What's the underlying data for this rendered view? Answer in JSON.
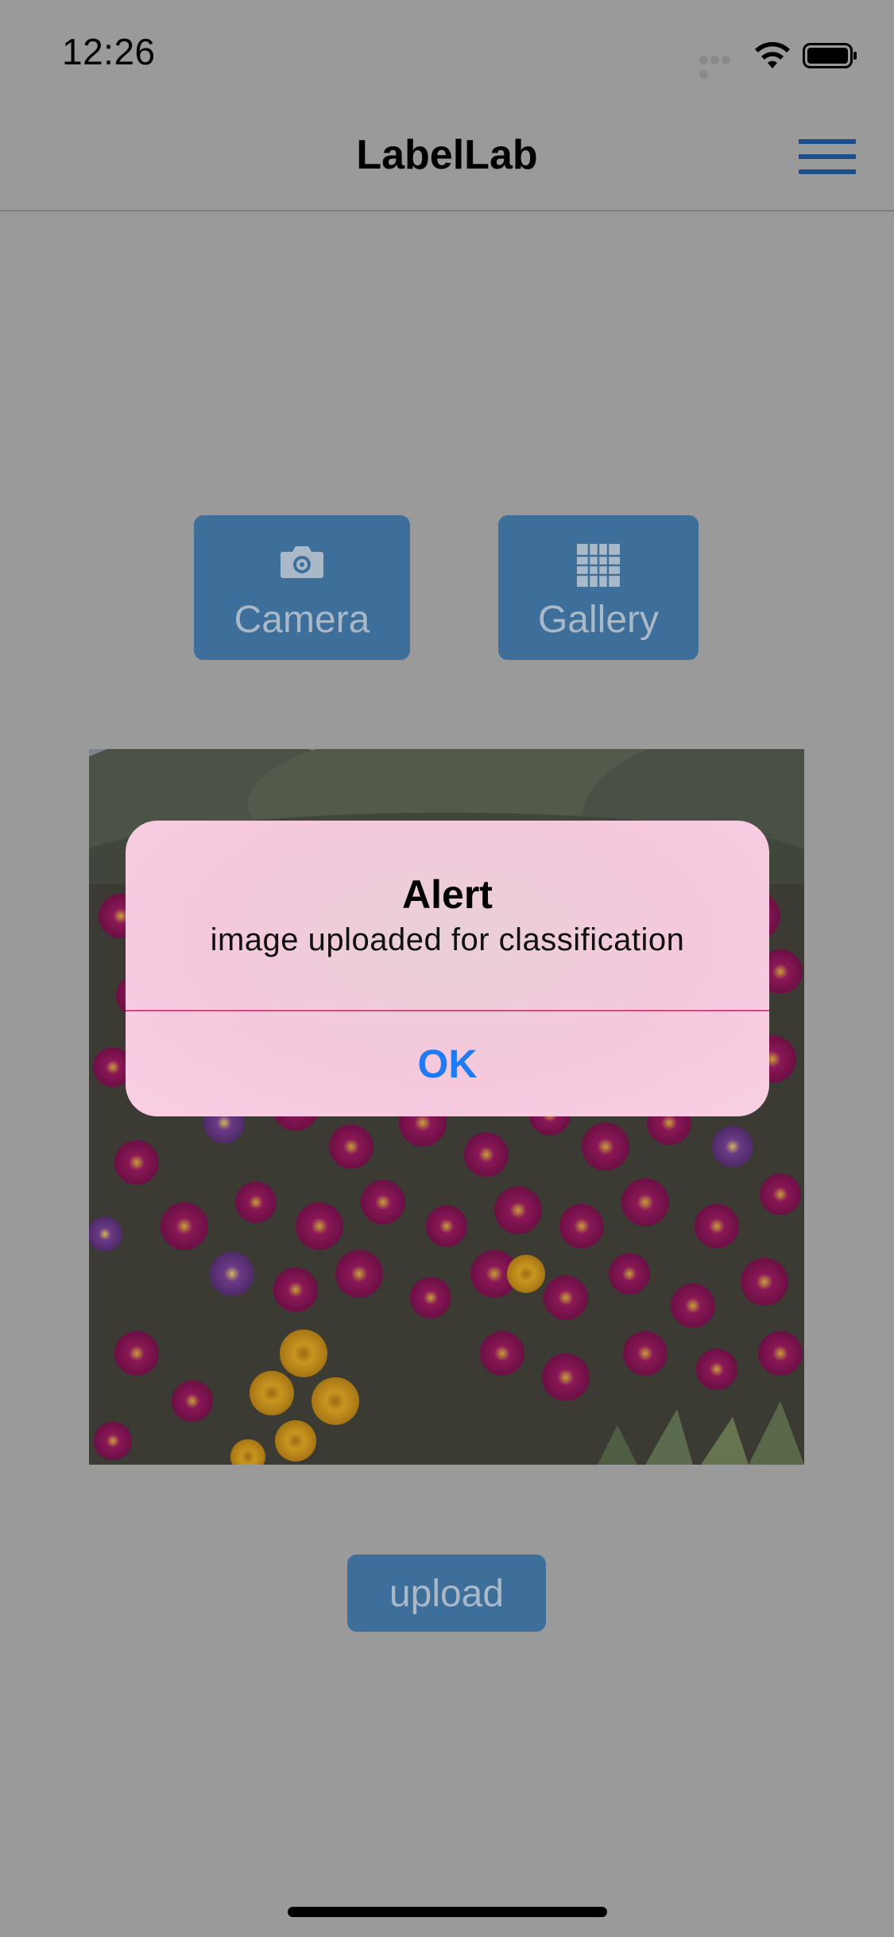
{
  "status_bar": {
    "time": "12:26"
  },
  "nav": {
    "title": "LabelLab",
    "menu_icon": "hamburger-menu-icon"
  },
  "actions": {
    "camera": {
      "label": "Camera",
      "icon": "camera-icon"
    },
    "gallery": {
      "label": "Gallery",
      "icon": "grid-icon"
    }
  },
  "image": {
    "description_icon": "flower-photo"
  },
  "upload": {
    "label": "upload"
  },
  "alert": {
    "title": "Alert",
    "message": "image uploaded for classification",
    "ok_label": "OK"
  },
  "colors": {
    "accent": "#1f7bf5",
    "button_blue": "#3e6e9a",
    "overlay": "#9a9a9a"
  }
}
